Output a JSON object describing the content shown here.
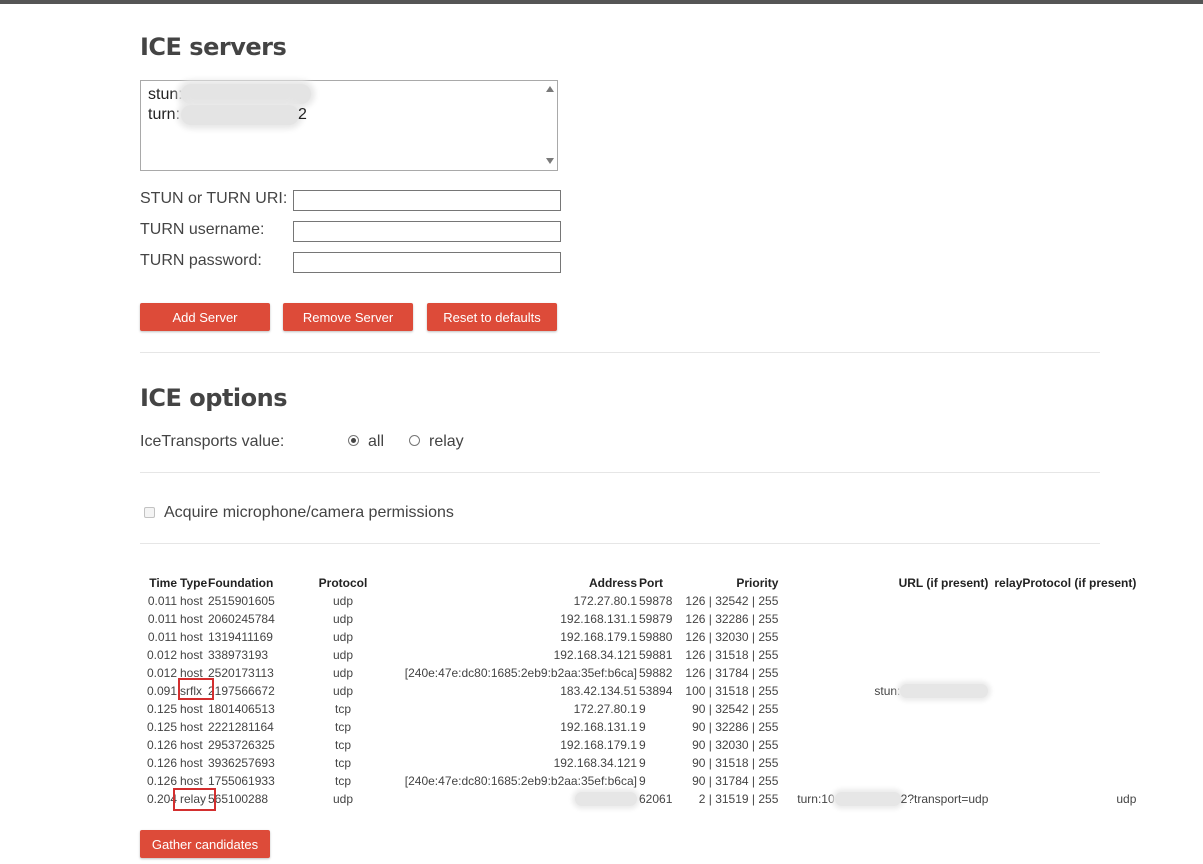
{
  "ice_servers": {
    "title": "ICE servers",
    "server_lines": [
      "stun:",
      "turn:",
      "2"
    ],
    "uri_label": "STUN or TURN URI:",
    "username_label": "TURN username:",
    "password_label": "TURN password:",
    "add_label": "Add Server",
    "remove_label": "Remove Server",
    "reset_label": "Reset to defaults"
  },
  "ice_options": {
    "title": "ICE options",
    "transports_label": "IceTransports value:",
    "option_all": "all",
    "option_relay": "relay",
    "selected": "all",
    "permissions_label": "Acquire microphone/camera permissions",
    "permissions_checked": false
  },
  "candidates": {
    "headers": [
      "Time",
      "Type",
      "Foundation",
      "Protocol",
      "Address",
      "Port",
      "Priority",
      "URL (if present)",
      "relayProtocol (if present)"
    ],
    "rows": [
      [
        "0.011",
        "host",
        "2515901605",
        "udp",
        "172.27.80.1",
        "59878",
        "126 | 32542 | 255",
        "",
        ""
      ],
      [
        "0.011",
        "host",
        "2060245784",
        "udp",
        "192.168.131.1",
        "59879",
        "126 | 32286 | 255",
        "",
        ""
      ],
      [
        "0.011",
        "host",
        "1319411169",
        "udp",
        "192.168.179.1",
        "59880",
        "126 | 32030 | 255",
        "",
        ""
      ],
      [
        "0.012",
        "host",
        "338973193",
        "udp",
        "192.168.34.121",
        "59881",
        "126 | 31518 | 255",
        "",
        ""
      ],
      [
        "0.012",
        "host",
        "2520173113",
        "udp",
        "[240e:47e:dc80:1685:2eb9:b2aa:35ef:b6ca]",
        "59882",
        "126 | 31784 | 255",
        "",
        ""
      ],
      [
        "0.091",
        "srflx",
        "2197566672",
        "udp",
        "183.42.134.51",
        "53894",
        "100 | 31518 | 255",
        "stun:",
        ""
      ],
      [
        "0.125",
        "host",
        "1801406513",
        "tcp",
        "172.27.80.1",
        "9",
        "90 | 32542 | 255",
        "",
        ""
      ],
      [
        "0.125",
        "host",
        "2221281164",
        "tcp",
        "192.168.131.1",
        "9",
        "90 | 32286 | 255",
        "",
        ""
      ],
      [
        "0.126",
        "host",
        "2953726325",
        "tcp",
        "192.168.179.1",
        "9",
        "90 | 32030 | 255",
        "",
        ""
      ],
      [
        "0.126",
        "host",
        "3936257693",
        "tcp",
        "192.168.34.121",
        "9",
        "90 | 31518 | 255",
        "",
        ""
      ],
      [
        "0.126",
        "host",
        "1755061933",
        "tcp",
        "[240e:47e:dc80:1685:2eb9:b2aa:35ef:b6ca]",
        "9",
        "90 | 31784 | 255",
        "",
        ""
      ],
      [
        "0.204",
        "relay",
        "565100288",
        "udp",
        "",
        "62061",
        "2 | 31519 | 255",
        "turn:10|2?transport=udp",
        "udp"
      ]
    ]
  },
  "gather_label": "Gather candidates",
  "colors": {
    "accent": "#dd4b39",
    "highlight": "#d32f2f"
  }
}
